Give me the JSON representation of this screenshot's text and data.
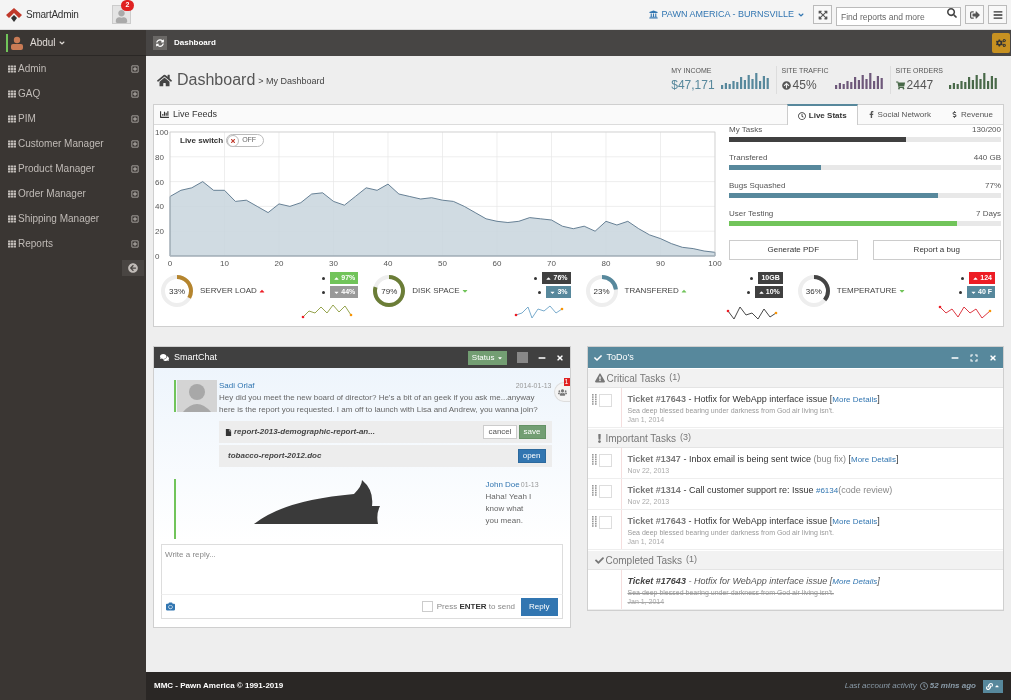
{
  "header": {
    "brand": "SmartAdmin",
    "notifications": "2",
    "location": "PAWN AMERICA - BURNSVILLE",
    "search": {
      "placeholder": "Find reports and more"
    }
  },
  "sidebar": {
    "user": "Abdul",
    "items": [
      {
        "label": "Admin"
      },
      {
        "label": "GAQ"
      },
      {
        "label": "PIM"
      },
      {
        "label": "Customer Manager"
      },
      {
        "label": "Product Manager"
      },
      {
        "label": "Order Manager"
      },
      {
        "label": "Shipping Manager"
      },
      {
        "label": "Reports"
      }
    ]
  },
  "ribbon": {
    "title": "Dashboard"
  },
  "page": {
    "title": "Dashboard",
    "subtitle": "> My Dashboard"
  },
  "stats": [
    {
      "kind": "income",
      "label": "MY INCOME",
      "value": "$47,171",
      "color": "#57889c"
    },
    {
      "kind": "traffic",
      "label": "SITE TRAFFIC",
      "value": "45%",
      "color": "#6e587a"
    },
    {
      "kind": "orders",
      "label": "SITE ORDERS",
      "value": "2447",
      "color": "#496949"
    }
  ],
  "live_feeds": {
    "title": "Live Feeds",
    "tabs": [
      {
        "kind": "clock",
        "label": "Live Stats",
        "selected": true
      },
      {
        "kind": "facebook",
        "label": "Social Network",
        "selected": false
      },
      {
        "kind": "dollar",
        "label": "Revenue",
        "selected": false
      }
    ],
    "live_switch": {
      "label": "Live switch",
      "state": "OFF",
      "on": false
    },
    "chart_data": {
      "type": "area",
      "x": [
        0,
        2,
        4,
        6,
        8,
        10,
        12,
        14,
        16,
        18,
        20,
        22,
        24,
        26,
        28,
        30,
        32,
        34,
        36,
        38,
        40,
        42,
        44,
        46,
        48,
        50,
        52,
        54,
        56,
        58,
        60,
        62,
        64,
        66,
        68,
        70,
        72,
        74,
        76,
        78,
        80,
        82,
        84,
        86,
        88,
        90,
        92,
        94,
        96,
        98,
        100
      ],
      "grid": true,
      "series": [
        {
          "color": "#58748a",
          "values": [
            48,
            53,
            55,
            60,
            53,
            53,
            44,
            45,
            40,
            35,
            42,
            40,
            43,
            50,
            51,
            44,
            41,
            48,
            55,
            53,
            58,
            50,
            48,
            46,
            47,
            45,
            44,
            40,
            35,
            30,
            28,
            27,
            28,
            31,
            30,
            29,
            24,
            22,
            24,
            20,
            28,
            25,
            28,
            22,
            17,
            14,
            10,
            7,
            6,
            4,
            3
          ]
        }
      ],
      "xlim": [
        0,
        100
      ],
      "ylim": [
        0,
        100
      ],
      "xticks": [
        0,
        10,
        20,
        30,
        40,
        50,
        60,
        70,
        80,
        90,
        100
      ],
      "yticks": [
        0,
        20,
        40,
        60,
        80,
        100
      ]
    },
    "tasks": [
      {
        "label": "My Tasks",
        "value": "130/200",
        "level": 0.65,
        "color": "#404040"
      },
      {
        "label": "Transfered",
        "value": "440 GB",
        "level": 0.34,
        "color": "#57889c"
      },
      {
        "label": "Bugs Squashed",
        "value": "77%",
        "level": 0.77,
        "color": "#57889c"
      },
      {
        "label": "User Testing",
        "value": "7 Days",
        "level": 0.84,
        "color": "#71c45a"
      }
    ],
    "buttons": [
      "Generate PDF",
      "Report a bug"
    ],
    "gauges": [
      {
        "label": "SERVER LOAD",
        "value": "33%",
        "level": 0.33,
        "color": "#b5852e",
        "rising": true,
        "alert": true,
        "badges": [
          {
            "text": "97%",
            "kind": "rise",
            "color": "#71c45a"
          },
          {
            "text": "44%",
            "kind": "fall",
            "color": "#999999"
          }
        ]
      },
      {
        "label": "DISK SPACE",
        "value": "79%",
        "level": 0.79,
        "color": "#6b7d37",
        "rising": false,
        "alert": false,
        "badges": [
          {
            "text": "76%",
            "kind": "rise",
            "color": "#404040"
          },
          {
            "text": "3%",
            "kind": "fall",
            "color": "#57889c"
          }
        ]
      },
      {
        "label": "TRANSFERED",
        "value": "23%",
        "level": 0.23,
        "color": "#57889c",
        "rising": true,
        "alert": false,
        "badges": [
          {
            "text": "10GB",
            "kind": "plain",
            "color": "#404040"
          },
          {
            "text": "10%",
            "kind": "rise",
            "color": "#404040"
          }
        ]
      },
      {
        "label": "TEMPERATURE",
        "value": "36%",
        "level": 0.36,
        "color": "#444444",
        "rising": false,
        "alert": false,
        "badges": [
          {
            "text": "124",
            "kind": "rise",
            "color": "#ed1c24"
          },
          {
            "text": "40 F",
            "kind": "fall",
            "color": "#57889c"
          }
        ]
      }
    ]
  },
  "chat": {
    "title": "SmartChat",
    "status": "Status",
    "users_badge": "1",
    "messages": [
      {
        "author": "Sadi Orlaf",
        "time": "2014-01-13",
        "text": "Hey did you meet the new board of director? He's a bit of an geek if you ask me...anyway here is the report you requested. I am off to launch with Lisa and Andrew, you wanna join?",
        "attachments": [
          {
            "kind": "file",
            "name": "report-2013-demographic-report-an...",
            "actions": [
              {
                "kind": "default",
                "label": "cancel"
              },
              {
                "kind": "success",
                "label": "save"
              }
            ]
          },
          {
            "kind": "plain",
            "name": "tobacco-report-2012.doc",
            "actions": [
              {
                "kind": "primary",
                "label": "open"
              }
            ]
          }
        ]
      },
      {
        "author": "John Doe",
        "time": "01-13",
        "text": "Haha! Yeah I know what you mean."
      }
    ],
    "reply": {
      "placeholder": "Write a reply...",
      "enter_label": "Press **ENTER** to send",
      "enter_checked": false,
      "button": "Reply"
    }
  },
  "todo": {
    "title": "ToDo's",
    "sections": [
      {
        "kind": "critical",
        "title": "Critical Tasks",
        "count": "(1)",
        "items": [
          {
            "checked": false,
            "done": false,
            "parts": [
              {
                "kind": "ticket",
                "text": "Ticket #17643"
              },
              {
                "kind": "text",
                "text": " - Hotfix for WebApp interface issue ["
              },
              {
                "kind": "link",
                "text": "More Details"
              },
              {
                "kind": "text",
                "text": "]"
              }
            ],
            "description": "Sea deep blessed bearing under darkness from God air living isn't.",
            "date": "Jan 1, 2014"
          }
        ]
      },
      {
        "kind": "important",
        "title": "Important Tasks",
        "count": "(3)",
        "items": [
          {
            "checked": false,
            "done": false,
            "parts": [
              {
                "kind": "ticket",
                "text": "Ticket #1347"
              },
              {
                "kind": "text",
                "text": " - Inbox email is being sent twice "
              },
              {
                "kind": "note",
                "text": "(bug fix)"
              },
              {
                "kind": "text",
                "text": " ["
              },
              {
                "kind": "link",
                "text": "More Details"
              },
              {
                "kind": "text",
                "text": "]"
              }
            ],
            "date": "Nov 22, 2013"
          },
          {
            "checked": false,
            "done": false,
            "parts": [
              {
                "kind": "ticket",
                "text": "Ticket #1314"
              },
              {
                "kind": "text",
                "text": " - Call customer support re: Issue "
              },
              {
                "kind": "link",
                "text": "#6134"
              },
              {
                "kind": "note",
                "text": "(code review)"
              }
            ],
            "date": "Nov 22, 2013"
          },
          {
            "checked": false,
            "done": false,
            "parts": [
              {
                "kind": "ticket",
                "text": "Ticket #17643"
              },
              {
                "kind": "text",
                "text": " - Hotfix for WebApp interface issue ["
              },
              {
                "kind": "link",
                "text": "More Details"
              },
              {
                "kind": "text",
                "text": "]"
              }
            ],
            "description": "Sea deep blessed bearing under darkness from God air living isn't.",
            "date": "Jan 1, 2014"
          }
        ]
      },
      {
        "kind": "completed",
        "title": "Completed Tasks",
        "count": "(1)",
        "items": [
          {
            "done": true,
            "parts": [
              {
                "kind": "ticket",
                "text": "Ticket #17643"
              },
              {
                "kind": "text",
                "text": " - Hotfix for WebApp interface issue ["
              },
              {
                "kind": "link",
                "text": "More Details"
              },
              {
                "kind": "text",
                "text": "]"
              }
            ],
            "description": "Sea deep blessed bearing under darkness from God air living isn't.",
            "date": "Jan 1, 2014"
          }
        ]
      }
    ]
  },
  "footer": {
    "copyright": "MMC - Pawn America © 1991-2019",
    "activity_label": "Last account activity",
    "activity_time": "52 mins ago"
  }
}
